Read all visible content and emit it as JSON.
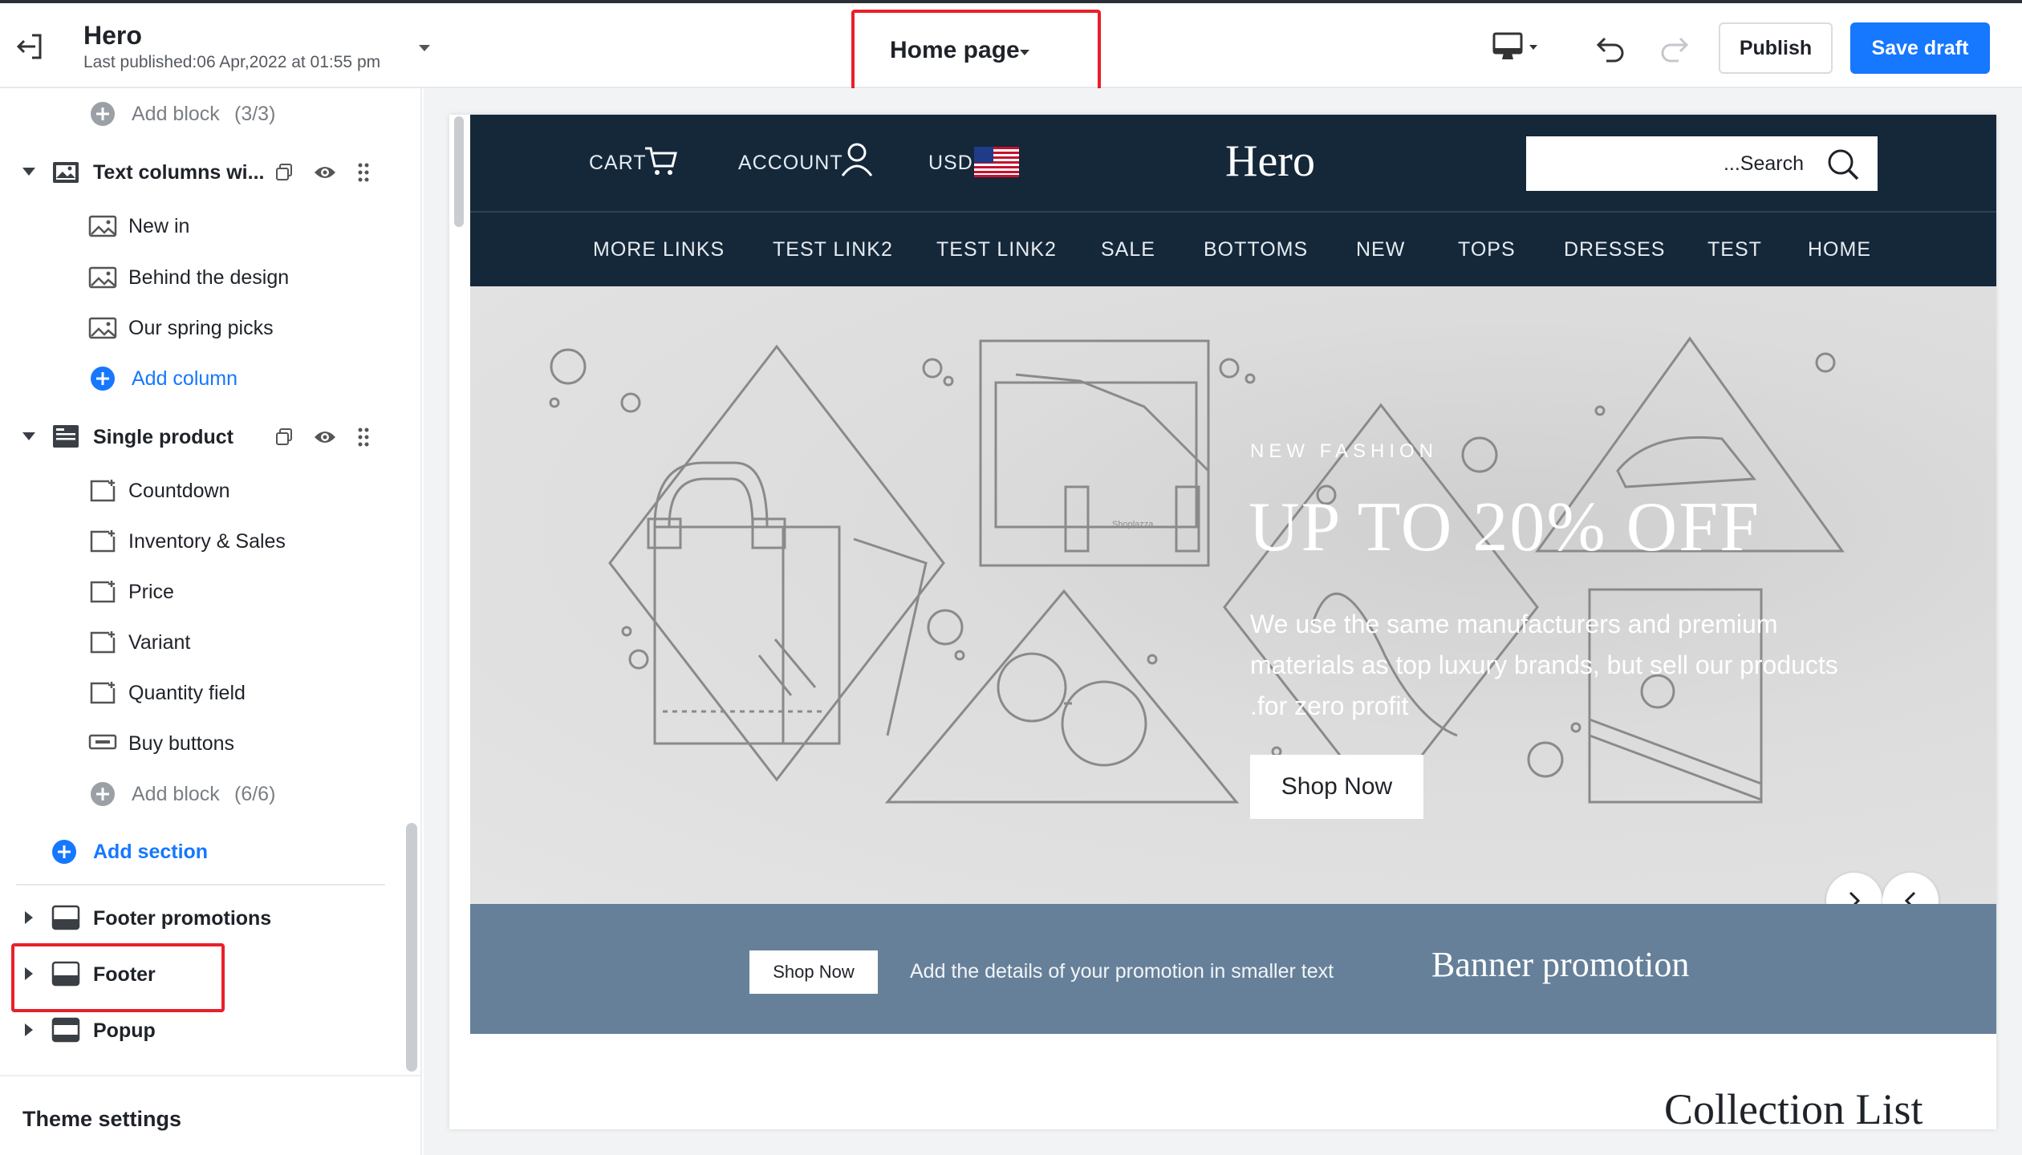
{
  "topbar": {
    "title": "Hero",
    "subtitle": "Last published:06 Apr,2022 at 01:55 pm",
    "page_select": "Home page",
    "publish_label": "Publish",
    "save_label": "Save draft"
  },
  "sidebar": {
    "rows": [
      {
        "label": "Add block",
        "count": "(3/3)"
      },
      {
        "label": "Text columns wi..."
      },
      {
        "label": "New in"
      },
      {
        "label": "Behind the design"
      },
      {
        "label": "Our spring picks"
      },
      {
        "label": "Add column"
      },
      {
        "label": "Single product"
      },
      {
        "label": "Countdown"
      },
      {
        "label": "Inventory & Sales"
      },
      {
        "label": "Price"
      },
      {
        "label": "Variant"
      },
      {
        "label": "Quantity field"
      },
      {
        "label": "Buy buttons"
      },
      {
        "label": "Add block",
        "count": "(6/6)"
      },
      {
        "label": "Add section"
      },
      {
        "label": "Footer promotions"
      },
      {
        "label": "Footer"
      },
      {
        "label": "Popup"
      }
    ],
    "theme_settings": "Theme settings"
  },
  "store": {
    "header": {
      "cart": "CART",
      "account": "ACCOUNT",
      "currency": "USD",
      "brand": "Hero",
      "search": "...Search"
    },
    "nav": [
      "MORE LINKS",
      "TEST LINK2",
      "TEST LINK2",
      "SALE",
      "BOTTOMS",
      "NEW",
      "TOPS",
      "DRESSES",
      "TEST",
      "HOME"
    ],
    "hero": {
      "kicker": "NEW FASHION",
      "title": "UP TO 20% OFF",
      "desc_line1": "We use the same manufacturers and premium",
      "desc_line2": "materials as top luxury brands, but sell our products",
      "desc_line3": ".for zero profit",
      "button": "Shop Now",
      "watermark": "Shoplazza"
    },
    "promo": {
      "button": "Shop Now",
      "text": "Add the details of your promotion in smaller text",
      "title": "Banner promotion"
    },
    "collection_title": "Collection List"
  },
  "colors": {
    "accent": "#1677ff",
    "highlight": "#e8202a",
    "store_header": "#15283a",
    "promo_bg": "#66809a"
  }
}
